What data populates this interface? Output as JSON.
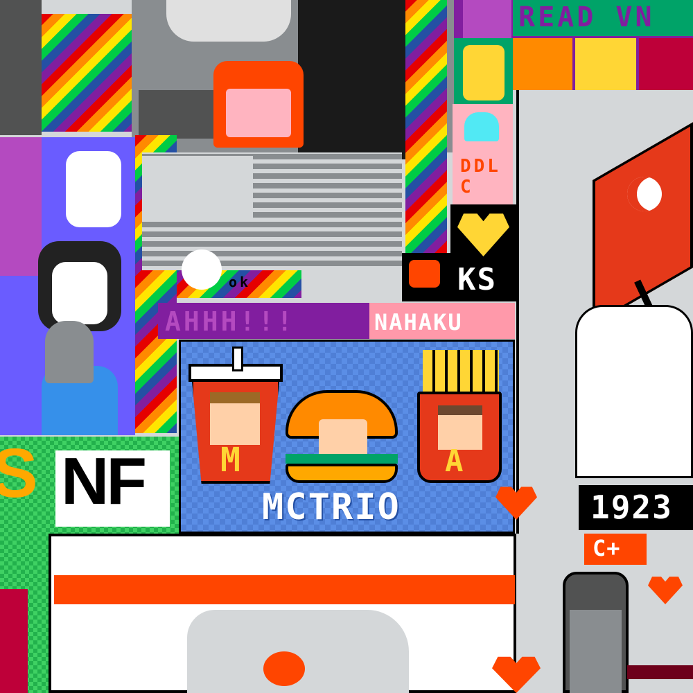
{
  "canvas": {
    "labels": {
      "read": "READ VN",
      "ahh": "AHHH!!!",
      "nahaku": "NAHAKU",
      "ks": "KS",
      "mctrio": "MCTRIO",
      "m_letter": "M",
      "a_letter": "A",
      "nf": "NF",
      "s_letter": "S",
      "year": "1923",
      "flag_label": "C+",
      "oval": "ok",
      "pink_letters": "DDLC"
    }
  },
  "colors": {
    "bg_grey": "#d4d7d9",
    "mc_blue": "#5b8ee6",
    "mc_red": "#e5391a",
    "fries_yellow": "#ffd635",
    "purple_banner": "#811e9f",
    "pink_banner": "#ff99aa",
    "teal_banner": "#00a368"
  }
}
